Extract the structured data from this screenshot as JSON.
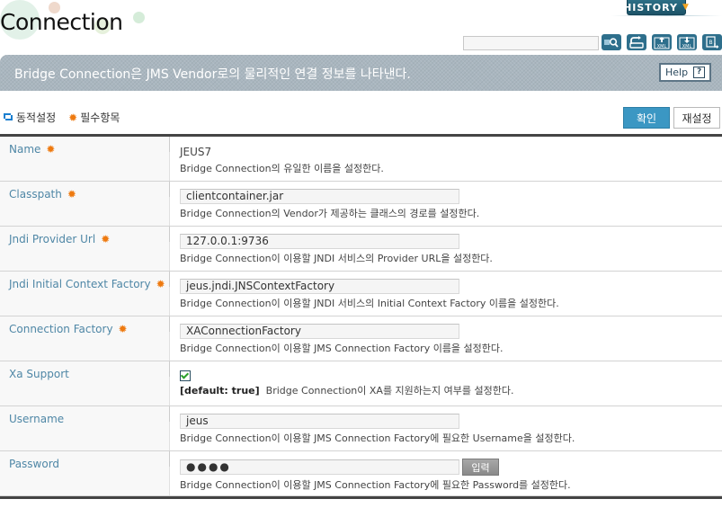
{
  "header": {
    "title": "Connection",
    "history_label": "HISTORY",
    "search": {
      "value": "",
      "placeholder": ""
    },
    "toolbar_icons": [
      "search-icon",
      "refresh-icon",
      "xml-export-icon",
      "xml-import-icon",
      "script-export-icon"
    ]
  },
  "banner": {
    "description": "Bridge Connection은 JMS Vendor로의 물리적인 연결 정보를 나타낸다.",
    "help_label": "Help",
    "help_glyph": "?"
  },
  "legend": {
    "dynamic_label": "동적설정",
    "required_label": "필수항목"
  },
  "actions": {
    "confirm_label": "확인",
    "reset_label": "재설정"
  },
  "colors": {
    "label_text": "#4f87a6",
    "required_star": "#ee7a10",
    "confirm_bg": "#3b97c3",
    "banner_bg": "#a9b6bf"
  },
  "fields": [
    {
      "label": "Name",
      "required": true,
      "type": "static",
      "value": "JEUS7",
      "description": "Bridge Connection의 유일한 이름을 설정한다."
    },
    {
      "label": "Classpath",
      "required": true,
      "type": "text",
      "value": "clientcontainer.jar",
      "description": "Bridge Connection의 Vendor가 제공하는 클래스의 경로를 설정한다."
    },
    {
      "label": "Jndi Provider Url",
      "required": true,
      "type": "text",
      "value": "127.0.0.1:9736",
      "description": "Bridge Connection이 이용할 JNDI 서비스의 Provider URL을 설정한다."
    },
    {
      "label": "Jndi Initial Context Factory",
      "required": true,
      "type": "text",
      "value": "jeus.jndi.JNSContextFactory",
      "description": "Bridge Connection이 이용할 JNDI 서비스의 Initial Context Factory 이름을 설정한다."
    },
    {
      "label": "Connection Factory",
      "required": true,
      "type": "text",
      "value": "XAConnectionFactory",
      "description": "Bridge Connection이 이용할 JMS Connection Factory 이름을 설정한다."
    },
    {
      "label": "Xa Support",
      "required": false,
      "type": "checkbox",
      "checked": true,
      "default_note": "[default: true]",
      "description": "Bridge Connection이 XA를 지원하는지 여부를 설정한다."
    },
    {
      "label": "Username",
      "required": false,
      "type": "text",
      "value": "jeus",
      "description": "Bridge Connection이 이용할 JMS Connection Factory에 필요한 Username을 설정한다."
    },
    {
      "label": "Password",
      "required": false,
      "type": "password",
      "value": "●●●●",
      "button_label": "입력",
      "description": "Bridge Connection이 이용할 JMS Connection Factory에 필요한 Password를 설정한다."
    }
  ]
}
